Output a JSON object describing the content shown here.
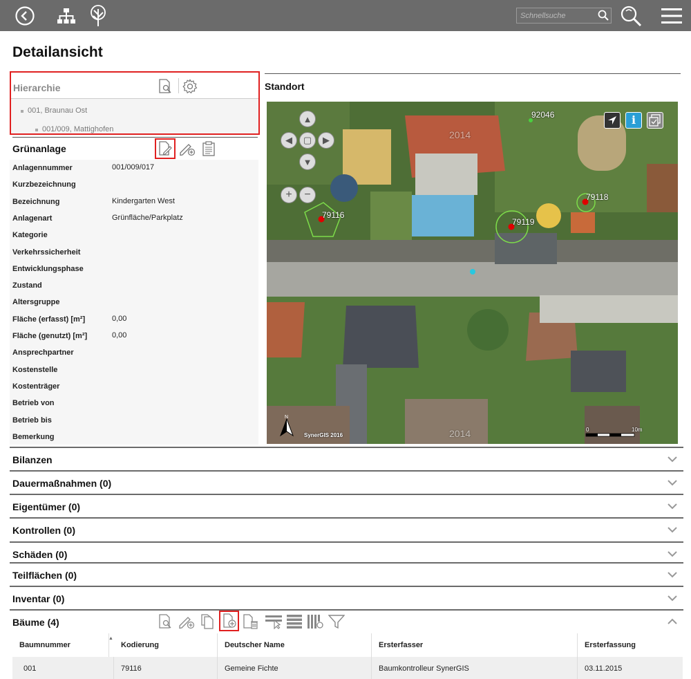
{
  "topbar": {
    "search_placeholder": "Schnellsuche",
    "icons": [
      "back-icon",
      "hierarchy-icon",
      "tree-icon",
      "search-icon",
      "zoom-search-icon",
      "menu-icon"
    ]
  },
  "page_title": "Detailansicht",
  "hierarchy": {
    "title": "Hierarchie",
    "items": [
      "001, Braunau Ost",
      "001/009, Mattighofen"
    ]
  },
  "gruenanlage": {
    "title": "Grünanlage",
    "properties": [
      {
        "label": "Anlagennummer",
        "value": "001/009/017"
      },
      {
        "label": "Kurzbezeichnung",
        "value": ""
      },
      {
        "label": "Bezeichnung",
        "value": "Kindergarten West"
      },
      {
        "label": "Anlagenart",
        "value": "Grünfläche/Parkplatz"
      },
      {
        "label": "Kategorie",
        "value": ""
      },
      {
        "label": "Verkehrssicherheit",
        "value": ""
      },
      {
        "label": "Entwicklungsphase",
        "value": ""
      },
      {
        "label": "Zustand",
        "value": ""
      },
      {
        "label": "Altersgruppe",
        "value": ""
      },
      {
        "label": "Fläche (erfasst) [m²]",
        "value": "0,00"
      },
      {
        "label": "Fläche (genutzt) [m²]",
        "value": "0,00"
      },
      {
        "label": "Ansprechpartner",
        "value": ""
      },
      {
        "label": "Kostenstelle",
        "value": ""
      },
      {
        "label": "Kostenträger",
        "value": ""
      },
      {
        "label": "Betrieb von",
        "value": ""
      },
      {
        "label": "Betrieb bis",
        "value": ""
      },
      {
        "label": "Bemerkung",
        "value": ""
      }
    ]
  },
  "standort": {
    "title": "Standort",
    "map_labels": {
      "tree1": "79116",
      "tree2": "79119",
      "tree3": "79118",
      "point": "92046",
      "credit": "SynerGIS 2016",
      "watermark": "2014",
      "watermark2": "2014",
      "scale_start": "0",
      "scale_end": "10m"
    }
  },
  "accordions": [
    {
      "label": "Bilanzen"
    },
    {
      "label": "Dauermaßnahmen (0)"
    },
    {
      "label": "Eigentümer (0)"
    },
    {
      "label": "Kontrollen (0)"
    },
    {
      "label": "Schäden (0)"
    },
    {
      "label": "Teilflächen (0)"
    },
    {
      "label": "Inventar (0)"
    }
  ],
  "baeume": {
    "title": "Bäume (4)",
    "columns": [
      "Baumnummer",
      "Kodierung",
      "Deutscher Name",
      "Ersterfasser",
      "Ersterfassung"
    ],
    "rows": [
      [
        "001",
        "79116",
        "Gemeine Fichte",
        "Baumkontrolleur SynerGIS",
        "03.11.2015"
      ]
    ]
  },
  "colors": {
    "topbar": "#6b6b6b",
    "highlight": "#e02020",
    "info": "#2a9fd6"
  }
}
